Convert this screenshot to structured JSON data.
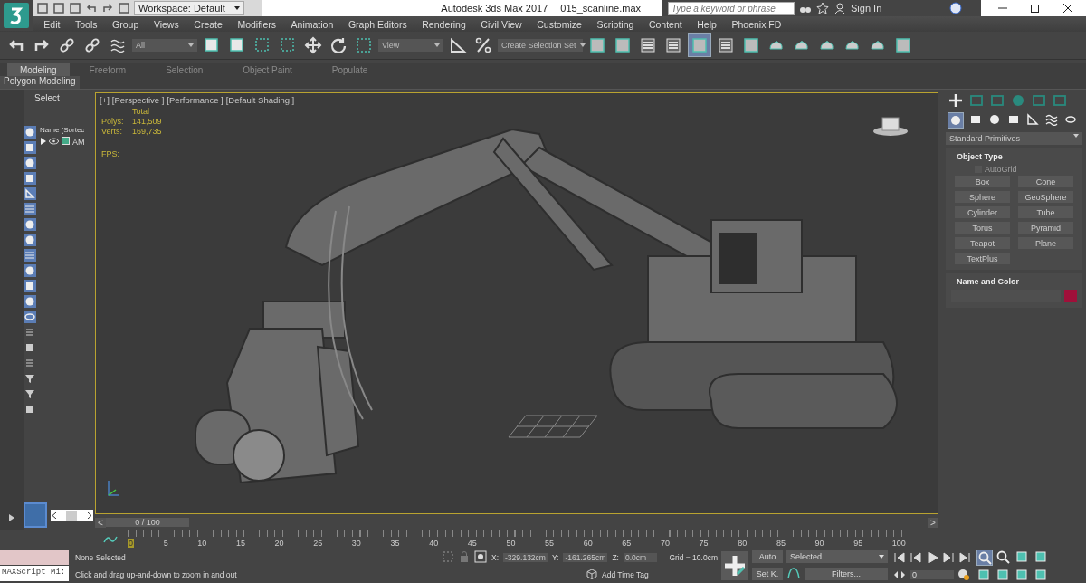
{
  "title_bar": {
    "workspace": "Workspace: Default",
    "app_title": "Autodesk 3ds Max 2017",
    "file_name": "015_scanline.max",
    "search": {
      "placeholder": "Type a keyword or phrase"
    },
    "sign_in": "Sign In"
  },
  "menu": [
    "Edit",
    "Tools",
    "Group",
    "Views",
    "Create",
    "Modifiers",
    "Animation",
    "Graph Editors",
    "Rendering",
    "Civil View",
    "Customize",
    "Scripting",
    "Content",
    "Help",
    "Phoenix FD"
  ],
  "toolbar": {
    "filter": "All",
    "coordinate_system": "View",
    "selection_set": "Create Selection Set"
  },
  "ribbon_tabs": [
    {
      "label": "Modeling",
      "selected": true
    },
    {
      "label": "Freeform",
      "selected": false
    },
    {
      "label": "Selection",
      "selected": false
    },
    {
      "label": "Object Paint",
      "selected": false
    },
    {
      "label": "Populate",
      "selected": false
    }
  ],
  "ribbon_panel": "Polygon Modeling",
  "scene_explorer": {
    "title": "Select",
    "column": "Name (Sortec",
    "items": [
      {
        "name": "AM",
        "expanded": false
      }
    ]
  },
  "viewport": {
    "labels": [
      "[+]",
      "[Perspective ]",
      "[Performance ]",
      "[Default Shading ]"
    ],
    "stats_heading": "Total",
    "stats": [
      {
        "label": "Polys:",
        "value": "141,509"
      },
      {
        "label": "Verts:",
        "value": "169,735"
      }
    ],
    "fps_label": "FPS:"
  },
  "command_panel": {
    "category": "Standard Primitives",
    "object_type": {
      "title": "Object Type",
      "autogrid": {
        "label": "AutoGrid",
        "checked": false,
        "disabled": true
      },
      "buttons": [
        "Box",
        "Cone",
        "Sphere",
        "GeoSphere",
        "Cylinder",
        "Tube",
        "Torus",
        "Pyramid",
        "Teapot",
        "Plane",
        "TextPlus"
      ]
    },
    "name_and_color": {
      "title": "Name and Color",
      "color": "#a0103a"
    }
  },
  "time_slider": {
    "prev": "<",
    "position": "0 / 100",
    "next": ">",
    "level": 0
  },
  "track_bar": {
    "ticks": [
      "0",
      "5",
      "10",
      "15",
      "20",
      "25",
      "30",
      "35",
      "40",
      "45",
      "50",
      "55",
      "60",
      "65",
      "70",
      "75",
      "80",
      "85",
      "90",
      "95",
      "100"
    ]
  },
  "status": {
    "maxscript": "MAXScript Mi:",
    "selection": "None Selected",
    "prompt": "Click and drag up-and-down to zoom in and out",
    "x_label": "X:",
    "x": "-329.132cm",
    "y_label": "Y:",
    "y": "-161.265cm",
    "z_label": "Z:",
    "z": "0.0cm",
    "grid": "Grid = 10.0cm",
    "time_tag": "Add Time Tag",
    "auto_key": "Auto",
    "set_key": "Set K.",
    "key_filter": "Selected",
    "filters": "Filters...",
    "frame": "0"
  }
}
